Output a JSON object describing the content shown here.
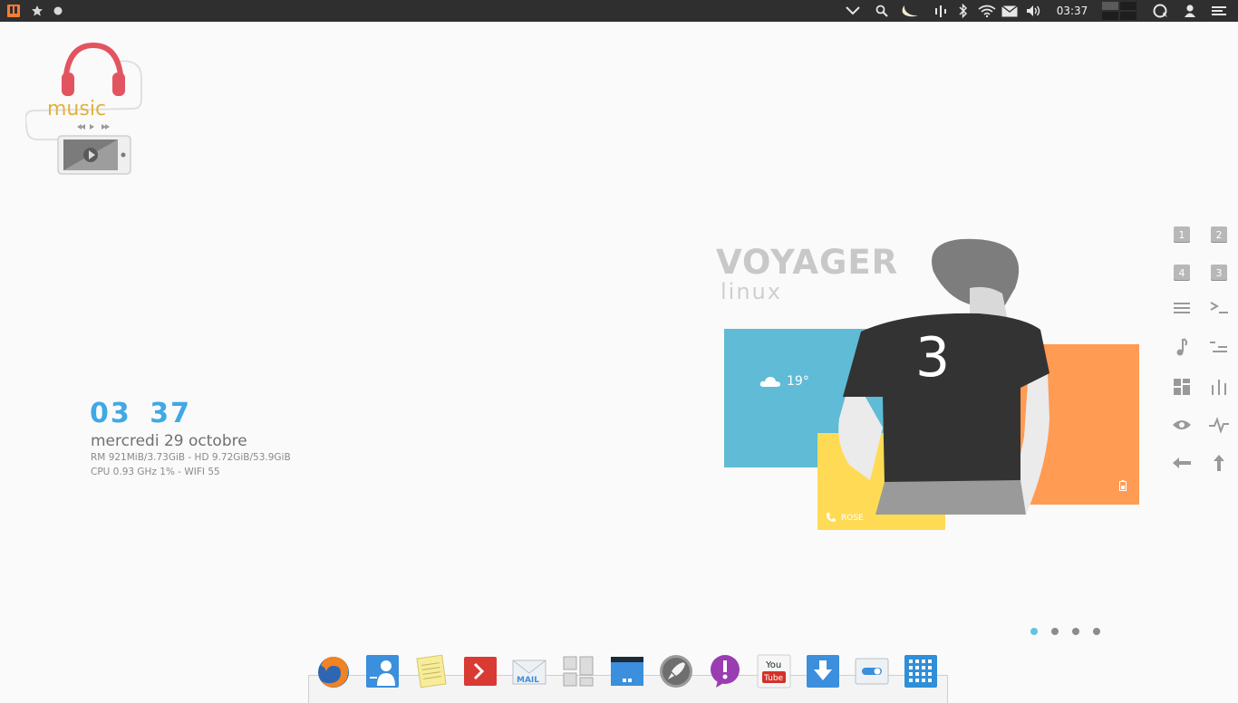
{
  "topbar": {
    "clock": "03:37",
    "icons": [
      "app-menu-icon",
      "favorites-star-icon",
      "dot-icon",
      "chevron-down-icon",
      "search-icon",
      "night-mode-icon",
      "volume-meter-icon",
      "bluetooth-icon",
      "wifi-icon",
      "mail-icon",
      "speaker-icon",
      "workspace-switcher-icon",
      "sync-icon",
      "user-icon",
      "menu-icon"
    ]
  },
  "music_widget": {
    "title": "music"
  },
  "clock_widget": {
    "hours": "03",
    "minutes": "37",
    "date": "mercredi 29 octobre",
    "sys_line1": "RM 921MiB/3.73GiB - HD 9.72GiB/53.9GiB",
    "sys_line2": "CPU 0.93 GHz 1% - WIFI 55"
  },
  "artwork": {
    "title": "VOYAGER",
    "subtitle": "linux",
    "shirt_number": "3",
    "weather_temp": "19°",
    "contact_label": "ROSE",
    "colors": {
      "blue": "#5fbbd6",
      "orange": "#ff9b53",
      "yellow": "#ffdb55",
      "shirt": "#333333"
    }
  },
  "launcher_grid": {
    "keys": [
      "1",
      "2",
      "4",
      "3"
    ],
    "icons": [
      "list-icon",
      "terminal-icon",
      "music-note-icon",
      "tree-icon",
      "tiles-icon",
      "bars-chart-icon",
      "eye-icon",
      "pulse-icon",
      "arrow-left-icon",
      "arrow-up-icon"
    ]
  },
  "pager": {
    "count": 4,
    "active_index": 0
  },
  "dock": {
    "items": [
      "firefox",
      "contacts",
      "notes",
      "terminal",
      "mail",
      "layout",
      "calendar",
      "launcher",
      "messages",
      "youtube",
      "downloads",
      "settings",
      "apps-grid"
    ],
    "youtube_label_top": "You",
    "youtube_label_bottom": "Tube",
    "mail_label": "MAIL"
  }
}
